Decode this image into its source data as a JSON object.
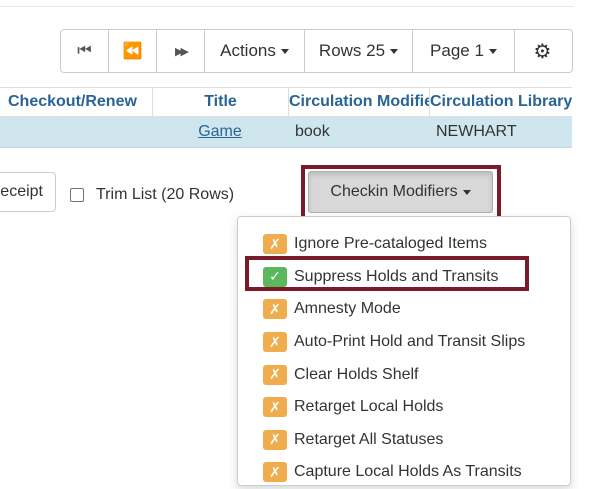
{
  "toolbar": {
    "first_icon": "⏮",
    "prev_icon": "⏪",
    "next_icon": "▶▶",
    "actions_label": "Actions",
    "rows_label": "Rows 25",
    "page_label": "Page 1",
    "settings_icon": "⚙"
  },
  "grid": {
    "columns": [
      "Checkout/Renew",
      "Title",
      "Circulation Modifier",
      "Circulation Library"
    ],
    "row": {
      "checkout": "",
      "title": "Game",
      "circ_modifier": "book",
      "circ_library": "NEWHART"
    }
  },
  "controls": {
    "receipt_label": "eceipt",
    "trim_label": "Trim List (20 Rows)",
    "checkin_modifiers_label": "Checkin Modifiers"
  },
  "menu": {
    "items": [
      {
        "label": "Ignore Pre-cataloged Items",
        "mark": "✗",
        "checked": false
      },
      {
        "label": "Suppress Holds and Transits",
        "mark": "✓",
        "checked": true
      },
      {
        "label": "Amnesty Mode",
        "mark": "✗",
        "checked": false
      },
      {
        "label": "Auto-Print Hold and Transit Slips",
        "mark": "✗",
        "checked": false
      },
      {
        "label": "Clear Holds Shelf",
        "mark": "✗",
        "checked": false
      },
      {
        "label": "Retarget Local Holds",
        "mark": "✗",
        "checked": false
      },
      {
        "label": "Retarget All Statuses",
        "mark": "✗",
        "checked": false
      },
      {
        "label": "Capture Local Holds As Transits",
        "mark": "✗",
        "checked": false
      }
    ]
  },
  "colors": {
    "highlight": "#7b1b2a",
    "unchecked_badge": "#f0ad4e",
    "checked_badge": "#5cb85c",
    "row_background": "#cfe6ef",
    "header_text": "#2a6496"
  }
}
